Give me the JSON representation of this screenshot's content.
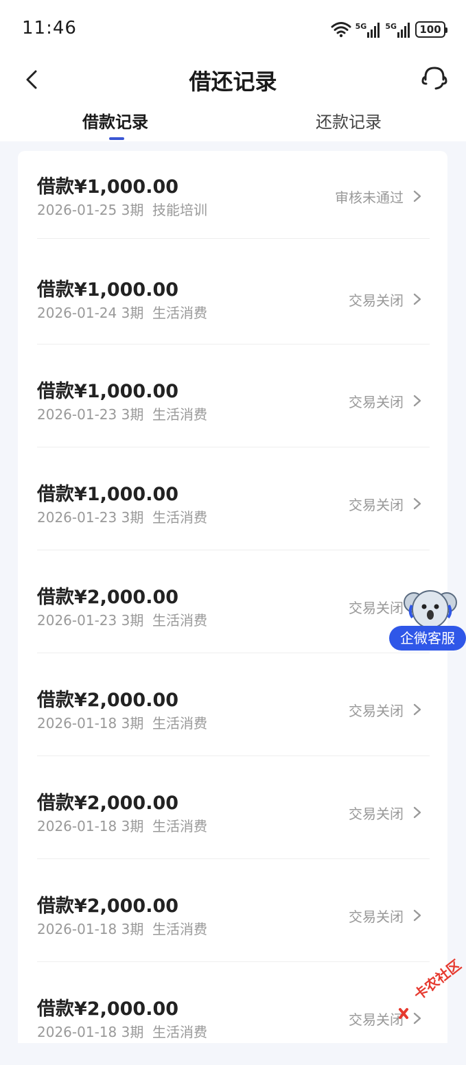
{
  "status_bar": {
    "time": "11:46",
    "signal_1": "5G",
    "signal_2": "5G",
    "battery": "100"
  },
  "nav": {
    "title": "借还记录"
  },
  "tabs": [
    {
      "label": "借款记录",
      "active": true
    },
    {
      "label": "还款记录",
      "active": false
    }
  ],
  "records": [
    {
      "amount": "借款¥1,000.00",
      "date": "2026-01-25",
      "term": "3期",
      "purpose": "技能培训",
      "status": "审核未通过"
    },
    {
      "amount": "借款¥1,000.00",
      "date": "2026-01-24",
      "term": "3期",
      "purpose": "生活消费",
      "status": "交易关闭"
    },
    {
      "amount": "借款¥1,000.00",
      "date": "2026-01-23",
      "term": "3期",
      "purpose": "生活消费",
      "status": "交易关闭"
    },
    {
      "amount": "借款¥1,000.00",
      "date": "2026-01-23",
      "term": "3期",
      "purpose": "生活消费",
      "status": "交易关闭"
    },
    {
      "amount": "借款¥2,000.00",
      "date": "2026-01-23",
      "term": "3期",
      "purpose": "生活消费",
      "status": "交易关闭"
    },
    {
      "amount": "借款¥2,000.00",
      "date": "2026-01-18",
      "term": "3期",
      "purpose": "生活消费",
      "status": "交易关闭"
    },
    {
      "amount": "借款¥2,000.00",
      "date": "2026-01-18",
      "term": "3期",
      "purpose": "生活消费",
      "status": "交易关闭"
    },
    {
      "amount": "借款¥2,000.00",
      "date": "2026-01-18",
      "term": "3期",
      "purpose": "生活消费",
      "status": "交易关闭"
    },
    {
      "amount": "借款¥2,000.00",
      "date": "2026-01-18",
      "term": "3期",
      "purpose": "生活消费",
      "status": "交易关闭"
    }
  ],
  "floating_service": {
    "label": "企微客服",
    "icon": "koala-mascot-icon"
  },
  "watermark": {
    "text": "卡农社区"
  },
  "colors": {
    "accent": "#3a56d4",
    "service_button": "#2f57e8",
    "muted_text": "#999999",
    "page_background": "#f4f6fb"
  }
}
